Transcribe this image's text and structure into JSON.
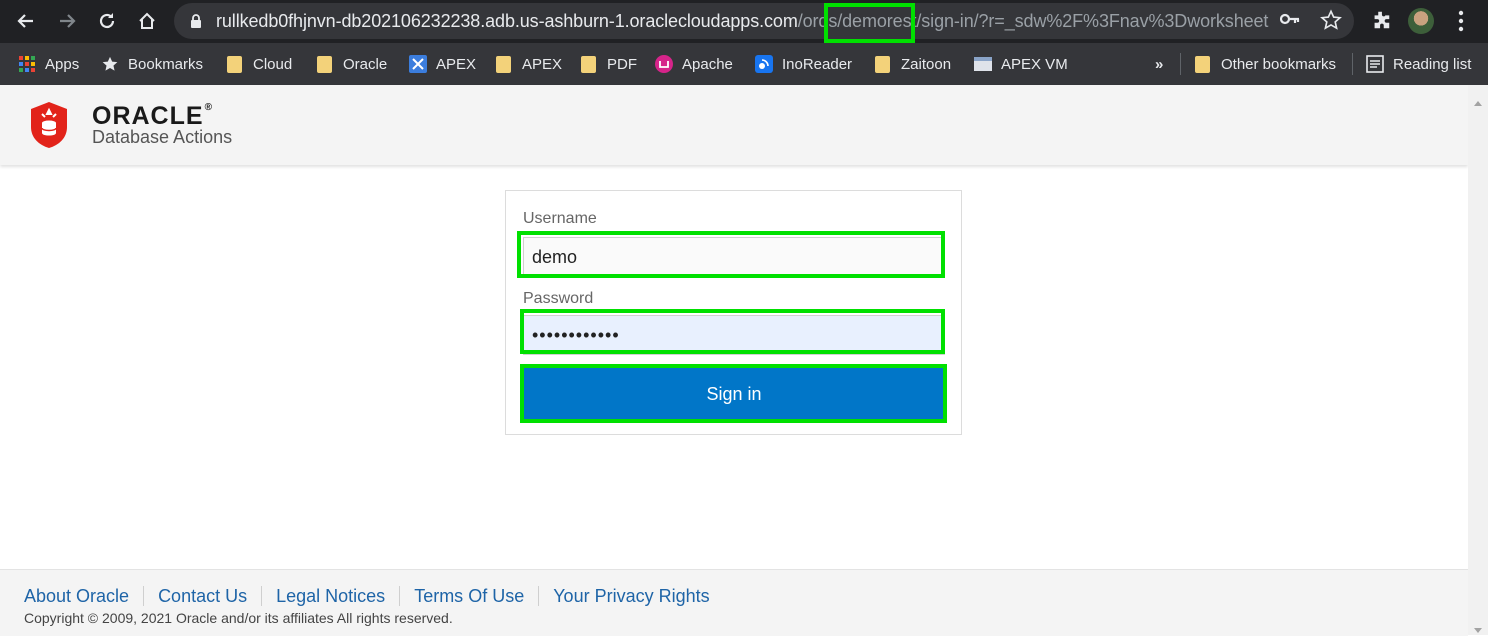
{
  "browser": {
    "url_host": "rullkedb0fhjnvn-db202106232238.adb.us-ashburn-1.oraclecloudapps.com",
    "url_path": "/ords/demorest/sign-in/?r=_sdw%2F%3Fnav%3Dworksheet",
    "url_path_before": "/ords/",
    "url_path_highlight": "demorest",
    "url_path_after": "/sign-in/?r=_sdw%2F%3Fnav%3Dworksheet",
    "icons": [
      "back-icon",
      "forward-icon",
      "reload-icon",
      "home-icon",
      "lock-icon",
      "key-icon",
      "star-icon",
      "extensions-icon",
      "profile-avatar",
      "menu-icon"
    ],
    "highlight_color": "#00e000"
  },
  "bookmarks": {
    "items": [
      {
        "label": "Apps",
        "icon": "apps-grid-icon"
      },
      {
        "label": "Bookmarks",
        "icon": "star-icon"
      },
      {
        "label": "Cloud",
        "icon": "folder-icon"
      },
      {
        "label": "Oracle",
        "icon": "folder-icon"
      },
      {
        "label": "APEX",
        "icon": "apex-icon"
      },
      {
        "label": "APEX",
        "icon": "folder-icon"
      },
      {
        "label": "PDF",
        "icon": "folder-icon"
      },
      {
        "label": "Apache",
        "icon": "apache-icon"
      },
      {
        "label": "InoReader",
        "icon": "inoreader-icon"
      },
      {
        "label": "Zaitoon",
        "icon": "folder-icon"
      },
      {
        "label": "APEX VM",
        "icon": "vm-icon"
      }
    ],
    "overflow": "»",
    "other": "Other bookmarks",
    "reading_list": "Reading list"
  },
  "header": {
    "brand": "ORACLE",
    "trademark": "®",
    "app_name": "Database Actions"
  },
  "login": {
    "username_label": "Username",
    "username_value": "demo",
    "password_label": "Password",
    "password_value": "••••••••••••",
    "signin_label": "Sign in",
    "button_color": "#0176c8"
  },
  "footer": {
    "links": [
      "About Oracle",
      "Contact Us",
      "Legal Notices",
      "Terms Of Use",
      "Your Privacy Rights"
    ],
    "copyright": "Copyright © 2009, 2021 Oracle and/or its affiliates All rights reserved."
  }
}
